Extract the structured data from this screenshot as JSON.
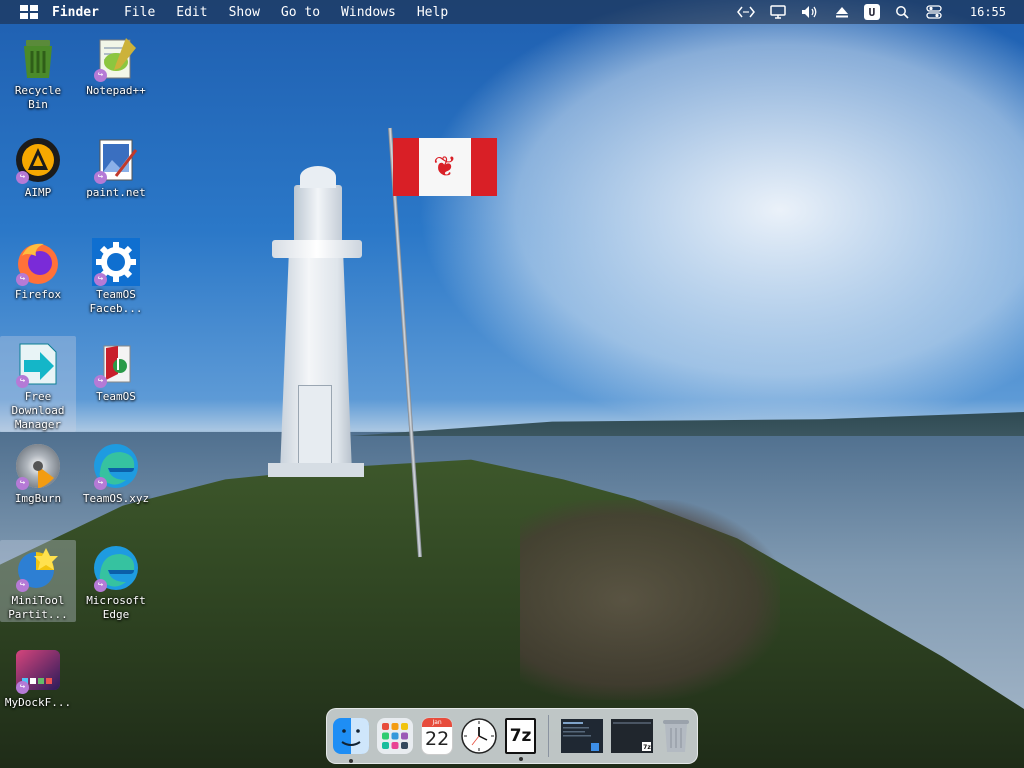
{
  "menubar": {
    "app_name": "Finder",
    "items": [
      "File",
      "Edit",
      "Show",
      "Go to",
      "Windows",
      "Help"
    ],
    "tray": {
      "network_icon": "network-code-icon",
      "display_icon": "monitor-icon",
      "volume_icon": "speaker-icon",
      "eject_icon": "eject-icon",
      "u_badge": "U",
      "search_icon": "search-icon",
      "control_icon": "control-center-icon"
    },
    "clock": "16:55"
  },
  "desktop": {
    "icons": [
      {
        "label1": "Recycle",
        "label2": "Bin",
        "icon": "recycle-bin-icon"
      },
      {
        "label1": "Notepad++",
        "label2": "",
        "icon": "notepadpp-icon"
      },
      {
        "label1": "AIMP",
        "label2": "",
        "icon": "aimp-icon"
      },
      {
        "label1": "paint.net",
        "label2": "",
        "icon": "paintnet-icon"
      },
      {
        "label1": "Firefox",
        "label2": "",
        "icon": "firefox-icon"
      },
      {
        "label1": "TeamOS",
        "label2": "Faceb...",
        "icon": "gear-icon"
      },
      {
        "label1": "Free",
        "label2": "Download",
        "label3": "Manager",
        "icon": "free-download-manager-icon"
      },
      {
        "label1": "TeamOS",
        "label2": "",
        "icon": "teamos-icon"
      },
      {
        "label1": "ImgBurn",
        "label2": "",
        "icon": "imgburn-icon"
      },
      {
        "label1": "TeamOS.xyz",
        "label2": "",
        "icon": "edge-icon"
      },
      {
        "label1": "MiniTool",
        "label2": "Partit...",
        "icon": "minitool-icon"
      },
      {
        "label1": "Microsoft",
        "label2": "Edge",
        "icon": "edge-icon"
      },
      {
        "label1": "MyDockF...",
        "label2": "",
        "icon": "mydockfinder-icon"
      }
    ]
  },
  "dock": {
    "items": [
      {
        "name": "finder",
        "icon": "finder-icon"
      },
      {
        "name": "launchpad",
        "icon": "launchpad-icon"
      },
      {
        "name": "calendar",
        "icon": "calendar-icon",
        "month": "Jan",
        "day": "22"
      },
      {
        "name": "clock",
        "icon": "clock-icon"
      },
      {
        "name": "7zip",
        "icon": "7zip-icon",
        "text": "7z"
      },
      {
        "name": "window-thumb-1",
        "icon": "window-thumbnail-icon"
      },
      {
        "name": "window-thumb-2",
        "icon": "window-thumbnail-icon",
        "text": "7z"
      },
      {
        "name": "trash",
        "icon": "trash-icon"
      }
    ]
  },
  "colors": {
    "menubar_bg": "#1e283c",
    "shortcut_badge": "#b57ad6",
    "flag_red": "#d91f26"
  }
}
